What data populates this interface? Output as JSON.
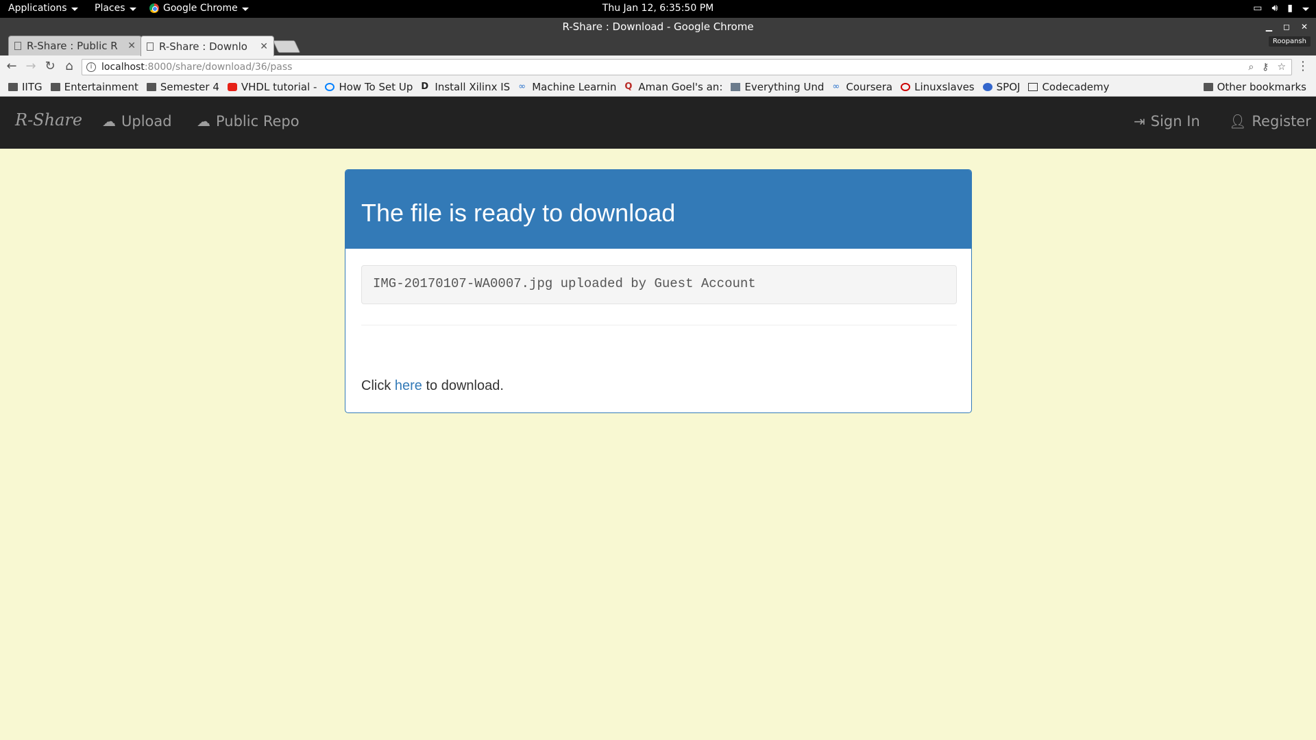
{
  "topbar": {
    "applications": "Applications",
    "places": "Places",
    "browser_app": "Google Chrome",
    "clock": "Thu Jan 12,  6:35:50 PM"
  },
  "window": {
    "title": "R-Share : Download - Google Chrome",
    "user_badge": "Roopansh"
  },
  "tabs": [
    {
      "label": "R-Share : Public R",
      "active": false
    },
    {
      "label": "R-Share : Downlo",
      "active": true
    }
  ],
  "address": {
    "host": "localhost",
    "path": ":8000/share/download/36/pass"
  },
  "bookmarks": [
    {
      "label": "IITG",
      "icon": "folder-icon"
    },
    {
      "label": "Entertainment",
      "icon": "folder-icon"
    },
    {
      "label": "Semester 4",
      "icon": "folder-icon"
    },
    {
      "label": "VHDL tutorial -",
      "icon": "youtube-icon"
    },
    {
      "label": "How To Set Up",
      "icon": "digitalocean-icon"
    },
    {
      "label": "Install Xilinx IS",
      "icon": "d-icon"
    },
    {
      "label": "Machine Learnin",
      "icon": "coursera-icon"
    },
    {
      "label": "Aman Goel's an:",
      "icon": "quora-icon"
    },
    {
      "label": "Everything Und",
      "icon": "site-icon"
    },
    {
      "label": "Coursera",
      "icon": "coursera-icon"
    },
    {
      "label": "Linuxslaves",
      "icon": "linuxslaves-icon"
    },
    {
      "label": "SPOJ",
      "icon": "spoj-icon"
    },
    {
      "label": "Codecademy",
      "icon": "codecademy-icon"
    }
  ],
  "other_bookmarks": "Other bookmarks",
  "site": {
    "brand": "R-Share",
    "nav": {
      "upload": "Upload",
      "public_repo": "Public Repo",
      "sign_in": "Sign In",
      "register": "Register"
    }
  },
  "panel": {
    "heading": "The file is ready to download",
    "file_info": "IMG-20170107-WA0007.jpg uploaded by Guest Account",
    "click_prefix": "Click ",
    "link_text": "here",
    "click_suffix": " to download."
  },
  "colors": {
    "page_bg": "#f8f8d2",
    "navbar_bg": "#222222",
    "panel_primary": "#337ab7"
  }
}
